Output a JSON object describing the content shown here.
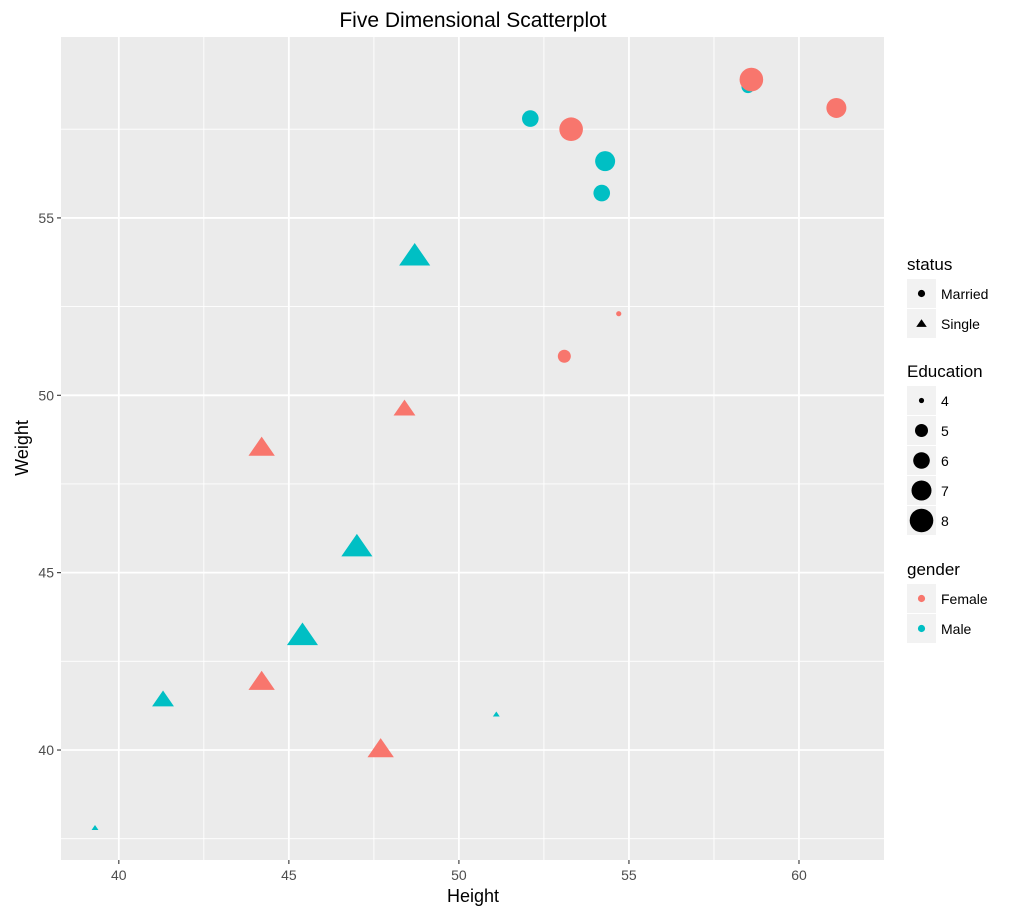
{
  "chart_data": {
    "type": "scatter",
    "title": "Five Dimensional Scatterplot",
    "xlabel": "Height",
    "ylabel": "Weight",
    "xlim": [
      38.3,
      62.5
    ],
    "ylim": [
      36.9,
      60.1
    ],
    "x_ticks": [
      40,
      45,
      50,
      55,
      60
    ],
    "y_ticks": [
      40,
      45,
      50,
      55
    ],
    "x_tick_labels": [
      "40",
      "45",
      "50",
      "55",
      "60"
    ],
    "y_tick_labels": [
      "40",
      "45",
      "50",
      "55"
    ],
    "grid": true,
    "legend_position": "right",
    "colors": {
      "Female": "#F8766D",
      "Male": "#00BFC4"
    },
    "legends": {
      "status": {
        "title": "status",
        "items": [
          {
            "label": "Married",
            "shape": "circle"
          },
          {
            "label": "Single",
            "shape": "triangle"
          }
        ]
      },
      "education": {
        "title": "Education",
        "items": [
          {
            "label": "4",
            "value": 4
          },
          {
            "label": "5",
            "value": 5
          },
          {
            "label": "6",
            "value": 6
          },
          {
            "label": "7",
            "value": 7
          },
          {
            "label": "8",
            "value": 8
          }
        ]
      },
      "gender": {
        "title": "gender",
        "items": [
          {
            "label": "Female"
          },
          {
            "label": "Male"
          }
        ]
      }
    },
    "points": [
      {
        "height": 52.1,
        "weight": 57.8,
        "status": "Married",
        "gender": "Male",
        "education": 6
      },
      {
        "height": 53.3,
        "weight": 57.5,
        "status": "Married",
        "gender": "Female",
        "education": 8
      },
      {
        "height": 54.3,
        "weight": 56.6,
        "status": "Married",
        "gender": "Male",
        "education": 7
      },
      {
        "height": 54.2,
        "weight": 55.7,
        "status": "Married",
        "gender": "Male",
        "education": 6
      },
      {
        "height": 58.5,
        "weight": 58.7,
        "status": "Married",
        "gender": "Male",
        "education": 5
      },
      {
        "height": 58.6,
        "weight": 58.9,
        "status": "Married",
        "gender": "Female",
        "education": 8
      },
      {
        "height": 61.1,
        "weight": 58.1,
        "status": "Married",
        "gender": "Female",
        "education": 7
      },
      {
        "height": 53.1,
        "weight": 51.1,
        "status": "Married",
        "gender": "Female",
        "education": 5
      },
      {
        "height": 54.7,
        "weight": 52.3,
        "status": "Married",
        "gender": "Female",
        "education": 4
      },
      {
        "height": 48.7,
        "weight": 53.9,
        "status": "Single",
        "gender": "Male",
        "education": 8
      },
      {
        "height": 48.4,
        "weight": 49.6,
        "status": "Single",
        "gender": "Female",
        "education": 6
      },
      {
        "height": 44.2,
        "weight": 48.5,
        "status": "Single",
        "gender": "Female",
        "education": 7
      },
      {
        "height": 47.0,
        "weight": 45.7,
        "status": "Single",
        "gender": "Male",
        "education": 8
      },
      {
        "height": 45.4,
        "weight": 43.2,
        "status": "Single",
        "gender": "Male",
        "education": 8
      },
      {
        "height": 44.2,
        "weight": 41.9,
        "status": "Single",
        "gender": "Female",
        "education": 7
      },
      {
        "height": 41.3,
        "weight": 41.4,
        "status": "Single",
        "gender": "Male",
        "education": 6
      },
      {
        "height": 47.7,
        "weight": 40.0,
        "status": "Single",
        "gender": "Female",
        "education": 7
      },
      {
        "height": 51.1,
        "weight": 41.0,
        "status": "Single",
        "gender": "Male",
        "education": 4
      },
      {
        "height": 39.3,
        "weight": 37.8,
        "status": "Single",
        "gender": "Male",
        "education": 4
      }
    ]
  }
}
